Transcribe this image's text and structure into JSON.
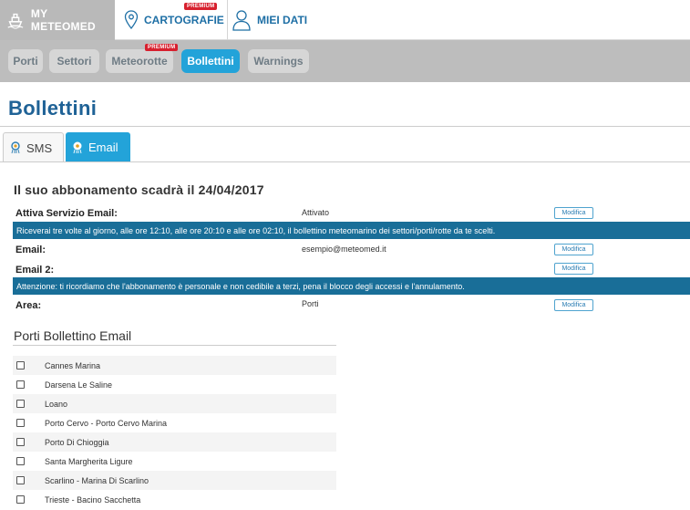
{
  "topnav": {
    "brand": "MY METEOMED",
    "cartografie": "CARTOGRAFIE",
    "cartografie_badge": "PREMIUM",
    "miei_dati": "MIEI DATI"
  },
  "subnav": {
    "tabs": [
      {
        "label": "Porti"
      },
      {
        "label": "Settori"
      },
      {
        "label": "Meteorotte",
        "badge": "PREMIUM"
      },
      {
        "label": "Bollettini",
        "active": true
      },
      {
        "label": "Warnings"
      }
    ]
  },
  "page": {
    "title": "Bollettini",
    "tabs": [
      {
        "label": "SMS"
      },
      {
        "label": "Email",
        "active": true
      }
    ]
  },
  "subscription": {
    "heading": "Il suo abbonamento scadrà il 24/04/2017",
    "modify_label": "Modifica",
    "attiva_label": "Attiva Servizio Email:",
    "attiva_value": "Attivato",
    "info_1": "Riceverai tre volte al giorno, alle ore 12:10, alle ore 20:10 e alle ore 02:10, il bollettino meteomarino dei settori/porti/rotte da te scelti.",
    "email_label": "Email:",
    "email_value": "esempio@meteomed.it",
    "email2_label": "Email 2:",
    "info_2": "Attenzione: ti ricordiamo che l'abbonamento è personale e non cedibile a terzi, pena il blocco degli accessi e l'annulamento.",
    "area_label": "Area:",
    "area_value": "Porti"
  },
  "porti": {
    "heading": "Porti Bollettino Email",
    "items": [
      "Cannes Marina",
      "Darsena Le Saline",
      "Loano",
      "Porto Cervo - Porto Cervo Marina",
      "Porto Di Chioggia",
      "Santa Margherita Ligure",
      "Scarlino - Marina Di Scarlino",
      "Trieste - Bacino Sacchetta"
    ]
  },
  "colors": {
    "brand_blue": "#1e6fa5",
    "active_tab": "#23a3d9",
    "info_bar": "#196e98",
    "premium_red": "#d7202e"
  }
}
